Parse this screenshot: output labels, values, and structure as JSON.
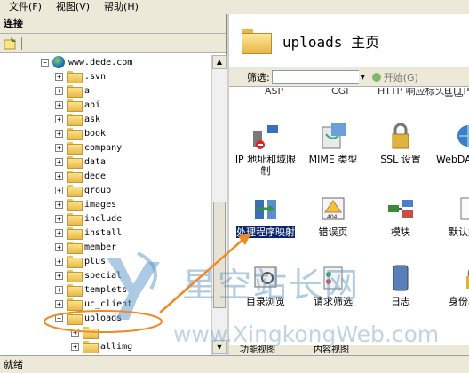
{
  "menu": [
    "文件(F)",
    "视图(V)",
    "帮助(H)"
  ],
  "connections_header": "连接",
  "tree": {
    "root": "www.dede.com",
    "folders": [
      ".svn",
      "a",
      "api",
      "ask",
      "book",
      "company",
      "data",
      "dede",
      "group",
      "images",
      "include",
      "install",
      "member",
      "plus",
      "special",
      "templets",
      "uc_client",
      "uploads",
      "",
      "allimg"
    ]
  },
  "page": {
    "title": "uploads 主页"
  },
  "filter": {
    "label": "筛选:",
    "go_label": "开始(G)"
  },
  "cut_labels": [
    "ASP",
    "CGI",
    "HTTP 响应标头",
    "HTTP 重定向"
  ],
  "features": [
    {
      "label": "IP 地址和域限制",
      "icon": "ip-restriction-icon"
    },
    {
      "label": "MIME 类型",
      "icon": "mime-type-icon"
    },
    {
      "label": "SSL 设置",
      "icon": "ssl-lock-icon"
    },
    {
      "label": "WebDAV 规则",
      "icon": "webdav-icon"
    },
    {
      "label": "处理程序映射",
      "icon": "handler-mapping-icon",
      "selected": true
    },
    {
      "label": "错误页",
      "icon": "error-pages-icon"
    },
    {
      "label": "模块",
      "icon": "modules-icon"
    },
    {
      "label": "默认文档",
      "icon": "default-document-icon"
    },
    {
      "label": "目录浏览",
      "icon": "directory-browsing-icon"
    },
    {
      "label": "请求筛选",
      "icon": "request-filtering-icon"
    },
    {
      "label": "日志",
      "icon": "logging-icon"
    },
    {
      "label": "身份验证",
      "icon": "authentication-icon"
    }
  ],
  "bottom_tabs": [
    "功能视图",
    "内容视图"
  ],
  "status": "就绪",
  "watermark": {
    "cn": "星空站长网",
    "en": "www.XingkongWeb.com"
  },
  "colors": {
    "selection": "#0a246a",
    "chrome": "#ece9d8",
    "annotation": "#f08a24"
  }
}
